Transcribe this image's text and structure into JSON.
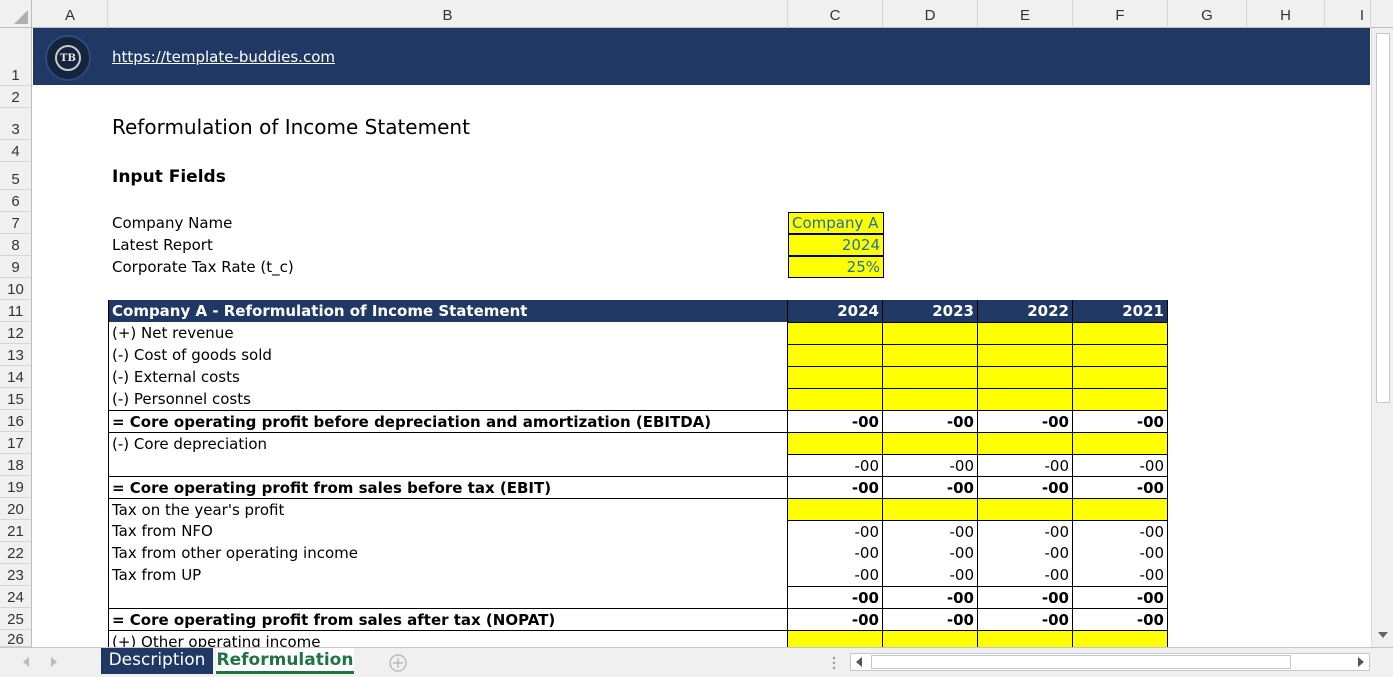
{
  "columns": [
    "A",
    "B",
    "C",
    "D",
    "E",
    "F",
    "G",
    "H",
    "I"
  ],
  "rows": [
    "1",
    "2",
    "3",
    "4",
    "5",
    "6",
    "7",
    "8",
    "9",
    "10",
    "11",
    "12",
    "13",
    "14",
    "15",
    "16",
    "17",
    "18",
    "19",
    "20",
    "21",
    "22",
    "23",
    "24",
    "25",
    "26"
  ],
  "banner": {
    "url": "https://template-buddies.com",
    "logo_text": "TB"
  },
  "title": "Reformulation of Income Statement",
  "input_header": "Input Fields",
  "inputs": [
    {
      "label": "Company Name",
      "value": "Company A"
    },
    {
      "label": "Latest Report",
      "value": "2024"
    },
    {
      "label": "Corporate Tax Rate (t_c)",
      "value": "25%"
    }
  ],
  "table": {
    "header": "Company A - Reformulation of Income Statement",
    "years": [
      "2024",
      "2023",
      "2022",
      "2021"
    ],
    "rows": [
      {
        "label": "(+) Net revenue",
        "values": [
          "",
          "",
          "",
          ""
        ]
      },
      {
        "label": "(-) Cost of goods sold",
        "values": [
          "",
          "",
          "",
          ""
        ]
      },
      {
        "label": "(-) External costs",
        "values": [
          "",
          "",
          "",
          ""
        ]
      },
      {
        "label": "(-) Personnel costs",
        "values": [
          "",
          "",
          "",
          ""
        ]
      },
      {
        "label": "= Core operating profit before depreciation and amortization (EBITDA)",
        "values": [
          "-00",
          "-00",
          "-00",
          "-00"
        ]
      },
      {
        "label": "(-) Core depreciation",
        "values": [
          "",
          "",
          "",
          ""
        ]
      },
      {
        "label": "",
        "values": [
          "-00",
          "-00",
          "-00",
          "-00"
        ]
      },
      {
        "label": "= Core operating profit from sales before tax (EBIT)",
        "values": [
          "-00",
          "-00",
          "-00",
          "-00"
        ]
      },
      {
        "label": "Tax on the year's profit",
        "values": [
          "",
          "",
          "",
          ""
        ]
      },
      {
        "label": "Tax from NFO",
        "values": [
          "-00",
          "-00",
          "-00",
          "-00"
        ]
      },
      {
        "label": "Tax from other operating income",
        "values": [
          "-00",
          "-00",
          "-00",
          "-00"
        ]
      },
      {
        "label": "Tax from UP",
        "values": [
          "-00",
          "-00",
          "-00",
          "-00"
        ]
      },
      {
        "label": "",
        "values": [
          "-00",
          "-00",
          "-00",
          "-00"
        ]
      },
      {
        "label": "= Core operating profit from sales after tax (NOPAT)",
        "values": [
          "-00",
          "-00",
          "-00",
          "-00"
        ]
      },
      {
        "label": "(+) Other operating income",
        "values": [
          "",
          "",
          "",
          ""
        ]
      }
    ]
  },
  "sheets": [
    "Description",
    "Reformulation"
  ],
  "colors": {
    "banner": "#1f3864",
    "input": "#ffff00",
    "input_text": "#1f6fb2",
    "active_tab": "#217346"
  }
}
